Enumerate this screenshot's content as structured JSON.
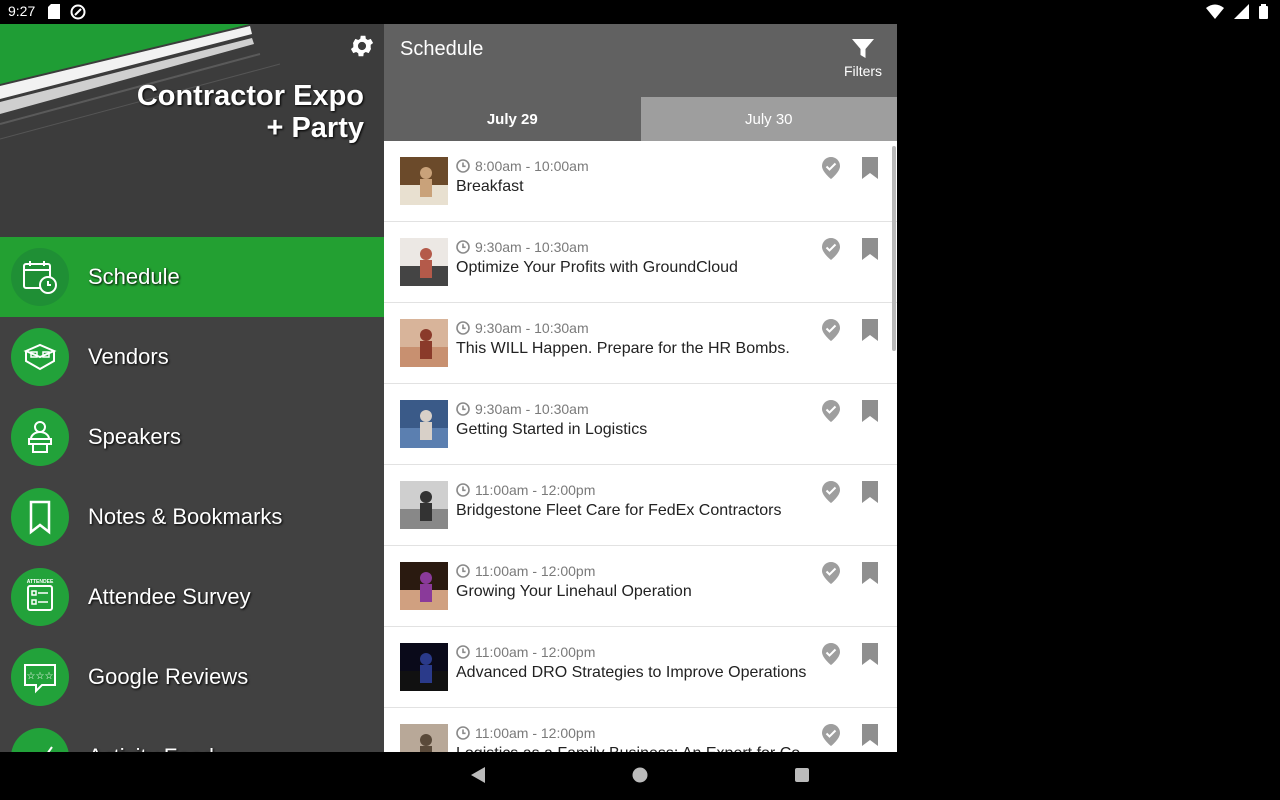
{
  "status_bar": {
    "time": "9:27"
  },
  "sidebar": {
    "logo_line1": "Contractor Expo",
    "logo_line2": "+ Party",
    "items": [
      {
        "label": "Schedule",
        "icon": "calendar-clock-icon",
        "active": true
      },
      {
        "label": "Vendors",
        "icon": "booth-icon",
        "active": false
      },
      {
        "label": "Speakers",
        "icon": "podium-speaker-icon",
        "active": false
      },
      {
        "label": "Notes & Bookmarks",
        "icon": "bookmark-icon",
        "active": false
      },
      {
        "label": "Attendee Survey",
        "icon": "survey-icon",
        "badge": "ATTENDEE",
        "active": false
      },
      {
        "label": "Google Reviews",
        "icon": "review-stars-icon",
        "active": false
      },
      {
        "label": "Activity Feed",
        "icon": "activity-icon",
        "active": false
      }
    ]
  },
  "toolbar": {
    "title": "Schedule",
    "filters_label": "Filters"
  },
  "tabs": [
    {
      "label": "July 29",
      "active": true
    },
    {
      "label": "July 30",
      "active": false
    }
  ],
  "sessions": [
    {
      "time": "8:00am - 10:00am",
      "title": "Breakfast"
    },
    {
      "time": "9:30am - 10:30am",
      "title": "Optimize Your Profits with GroundCloud"
    },
    {
      "time": "9:30am - 10:30am",
      "title": "This WILL Happen. Prepare for the HR Bombs."
    },
    {
      "time": "9:30am - 10:30am",
      "title": "Getting Started in Logistics"
    },
    {
      "time": "11:00am - 12:00pm",
      "title": "Bridgestone Fleet Care for FedEx Contractors"
    },
    {
      "time": "11:00am - 12:00pm",
      "title": "Growing Your Linehaul Operation"
    },
    {
      "time": "11:00am - 12:00pm",
      "title": "Advanced DRO Strategies to Improve Operations"
    },
    {
      "time": "11:00am - 12:00pm",
      "title": "Logistics as a Family Business: An Expert for Co"
    }
  ],
  "colors": {
    "accent_green": "#23a032",
    "toolbar_gray": "#616161",
    "sidebar_gray": "#414141"
  }
}
